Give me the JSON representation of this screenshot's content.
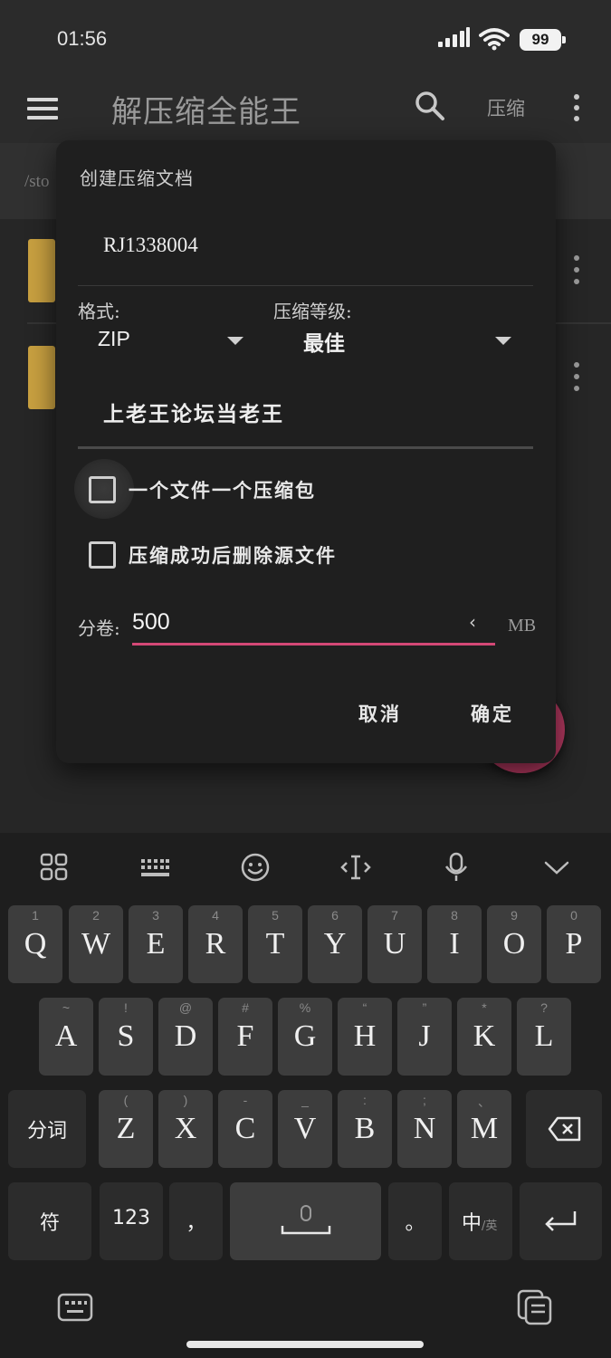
{
  "status_bar": {
    "time": "01:56",
    "battery": "99"
  },
  "app_bar": {
    "title": "解压缩全能王",
    "compress_label": "压缩"
  },
  "background": {
    "path_prefix": "/sto"
  },
  "dialog": {
    "title": "创建压缩文档",
    "archive_name": "RJ1338004",
    "format_label": "格式:",
    "format_value": "ZIP",
    "level_label": "压缩等级:",
    "level_value": "最佳",
    "comment": "上老王论坛当老王",
    "option_one_per_file": "一个文件一个压缩包",
    "option_delete_source": "压缩成功后删除源文件",
    "volume_label": "分卷:",
    "volume_value": "500",
    "volume_unit": "MB",
    "cancel_label": "取消",
    "ok_label": "确定"
  },
  "keyboard": {
    "row1": [
      {
        "hint": "1",
        "key": "Q"
      },
      {
        "hint": "2",
        "key": "W"
      },
      {
        "hint": "3",
        "key": "E"
      },
      {
        "hint": "4",
        "key": "R"
      },
      {
        "hint": "5",
        "key": "T"
      },
      {
        "hint": "6",
        "key": "Y"
      },
      {
        "hint": "7",
        "key": "U"
      },
      {
        "hint": "8",
        "key": "I"
      },
      {
        "hint": "9",
        "key": "O"
      },
      {
        "hint": "0",
        "key": "P"
      }
    ],
    "row2": [
      {
        "hint": "~",
        "key": "A"
      },
      {
        "hint": "!",
        "key": "S"
      },
      {
        "hint": "@",
        "key": "D"
      },
      {
        "hint": "#",
        "key": "F"
      },
      {
        "hint": "%",
        "key": "G"
      },
      {
        "hint": "“",
        "key": "H"
      },
      {
        "hint": "”",
        "key": "J"
      },
      {
        "hint": "*",
        "key": "K"
      },
      {
        "hint": "?",
        "key": "L"
      }
    ],
    "row3": [
      {
        "hint": "(",
        "key": "Z"
      },
      {
        "hint": ")",
        "key": "X"
      },
      {
        "hint": "-",
        "key": "C"
      },
      {
        "hint": "_",
        "key": "V"
      },
      {
        "hint": ":",
        "key": "B"
      },
      {
        "hint": ";",
        "key": "N"
      },
      {
        "hint": "、",
        "key": "M"
      }
    ],
    "segment_label": "分词",
    "symbols_label": "符",
    "numbers_label": "123",
    "comma": "，",
    "period": "。",
    "lang_main": "中",
    "lang_sub": "/英"
  }
}
